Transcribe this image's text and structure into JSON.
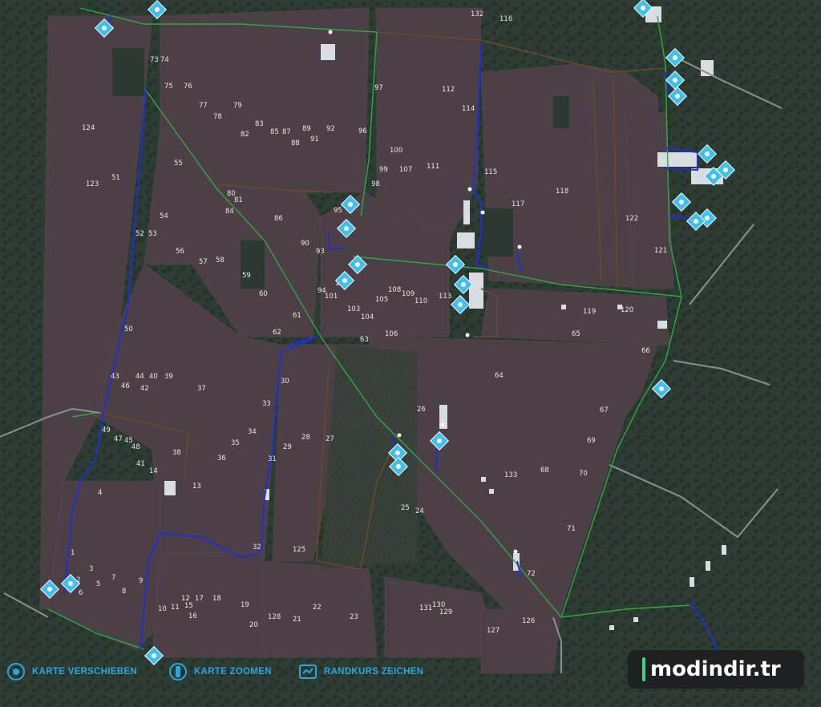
{
  "map": {
    "field_numbers": [
      {
        "label": "132",
        "pos": "a"
      },
      {
        "label": "116",
        "pos": "b"
      },
      {
        "label": "73",
        "pos": "c1"
      },
      {
        "label": "74",
        "pos": "c2"
      },
      {
        "label": "75",
        "pos": "d1"
      },
      {
        "label": "76",
        "pos": "d2"
      },
      {
        "label": "77",
        "pos": "e1"
      },
      {
        "label": "79",
        "pos": "e2"
      },
      {
        "label": "78",
        "pos": "e3"
      },
      {
        "label": "97",
        "pos": "f"
      },
      {
        "label": "112",
        "pos": "g"
      },
      {
        "label": "114",
        "pos": "h"
      },
      {
        "label": "124",
        "pos": "i"
      },
      {
        "label": "83",
        "pos": "j1"
      },
      {
        "label": "82",
        "pos": "j2"
      },
      {
        "label": "85",
        "pos": "j3"
      },
      {
        "label": "87",
        "pos": "j4"
      },
      {
        "label": "89",
        "pos": "j5"
      },
      {
        "label": "92",
        "pos": "j6"
      },
      {
        "label": "88",
        "pos": "j7"
      },
      {
        "label": "91",
        "pos": "j8"
      },
      {
        "label": "96",
        "pos": "k"
      },
      {
        "label": "100",
        "pos": "l"
      },
      {
        "label": "51",
        "pos": "m"
      },
      {
        "label": "123",
        "pos": "n"
      },
      {
        "label": "55",
        "pos": "o"
      },
      {
        "label": "99",
        "pos": "p1"
      },
      {
        "label": "107",
        "pos": "p2"
      },
      {
        "label": "111",
        "pos": "p3"
      },
      {
        "label": "115",
        "pos": "q"
      },
      {
        "label": "118",
        "pos": "r"
      },
      {
        "label": "98",
        "pos": "s"
      },
      {
        "label": "80",
        "pos": "t1"
      },
      {
        "label": "81",
        "pos": "t2"
      },
      {
        "label": "84",
        "pos": "t3"
      },
      {
        "label": "86",
        "pos": "t4"
      },
      {
        "label": "95",
        "pos": "u"
      },
      {
        "label": "117",
        "pos": "v"
      },
      {
        "label": "122",
        "pos": "w"
      },
      {
        "label": "54",
        "pos": "x"
      },
      {
        "label": "52",
        "pos": "y1"
      },
      {
        "label": "53",
        "pos": "y2"
      },
      {
        "label": "90",
        "pos": "z1"
      },
      {
        "label": "93",
        "pos": "z2"
      },
      {
        "label": "56",
        "pos": "aa"
      },
      {
        "label": "57",
        "pos": "ab1"
      },
      {
        "label": "58",
        "pos": "ab2"
      },
      {
        "label": "121",
        "pos": "ac"
      },
      {
        "label": "59",
        "pos": "ad"
      },
      {
        "label": "102",
        "pos": "ae"
      },
      {
        "label": "94",
        "pos": "af1"
      },
      {
        "label": "101",
        "pos": "af2"
      },
      {
        "label": "108",
        "pos": "ag1"
      },
      {
        "label": "109",
        "pos": "ag2"
      },
      {
        "label": "110",
        "pos": "ag3"
      },
      {
        "label": "105",
        "pos": "ag4"
      },
      {
        "label": "113",
        "pos": "ah"
      },
      {
        "label": "60",
        "pos": "ai"
      },
      {
        "label": "103",
        "pos": "aj"
      },
      {
        "label": "61",
        "pos": "ak1"
      },
      {
        "label": "104",
        "pos": "ak2"
      },
      {
        "label": "119",
        "pos": "al"
      },
      {
        "label": "120",
        "pos": "am"
      },
      {
        "label": "50",
        "pos": "an"
      },
      {
        "label": "62",
        "pos": "ao"
      },
      {
        "label": "106",
        "pos": "ap"
      },
      {
        "label": "65",
        "pos": "aq"
      },
      {
        "label": "63",
        "pos": "ar"
      },
      {
        "label": "66",
        "pos": "as"
      },
      {
        "label": "43",
        "pos": "at1"
      },
      {
        "label": "44",
        "pos": "at2"
      },
      {
        "label": "40",
        "pos": "at3"
      },
      {
        "label": "39",
        "pos": "at4"
      },
      {
        "label": "46",
        "pos": "at5"
      },
      {
        "label": "42",
        "pos": "at6"
      },
      {
        "label": "37",
        "pos": "au"
      },
      {
        "label": "30",
        "pos": "av"
      },
      {
        "label": "64",
        "pos": "aw"
      },
      {
        "label": "33",
        "pos": "ax"
      },
      {
        "label": "26",
        "pos": "ay"
      },
      {
        "label": "67",
        "pos": "az"
      },
      {
        "label": "49",
        "pos": "ba"
      },
      {
        "label": "47",
        "pos": "bb1"
      },
      {
        "label": "45",
        "pos": "bb2"
      },
      {
        "label": "48",
        "pos": "bb3"
      },
      {
        "label": "35",
        "pos": "bc"
      },
      {
        "label": "34",
        "pos": "bd"
      },
      {
        "label": "28",
        "pos": "be"
      },
      {
        "label": "27",
        "pos": "bf"
      },
      {
        "label": "29",
        "pos": "bg"
      },
      {
        "label": "69",
        "pos": "bh"
      },
      {
        "label": "38",
        "pos": "bi"
      },
      {
        "label": "36",
        "pos": "bj"
      },
      {
        "label": "41",
        "pos": "bk"
      },
      {
        "label": "31",
        "pos": "bl"
      },
      {
        "label": "14",
        "pos": "bm"
      },
      {
        "label": "68",
        "pos": "bn"
      },
      {
        "label": "133",
        "pos": "bo"
      },
      {
        "label": "70",
        "pos": "bp"
      },
      {
        "label": "13",
        "pos": "bq"
      },
      {
        "label": "4",
        "pos": "br"
      },
      {
        "label": "25",
        "pos": "bs1"
      },
      {
        "label": "24",
        "pos": "bs2"
      },
      {
        "label": "71",
        "pos": "bt"
      },
      {
        "label": "32",
        "pos": "bu"
      },
      {
        "label": "125",
        "pos": "bv"
      },
      {
        "label": "72",
        "pos": "bw"
      },
      {
        "label": "1",
        "pos": "bx"
      },
      {
        "label": "3",
        "pos": "by1"
      },
      {
        "label": "7",
        "pos": "by2"
      },
      {
        "label": "5",
        "pos": "by3"
      },
      {
        "label": "9",
        "pos": "by4"
      },
      {
        "label": "6",
        "pos": "by5"
      },
      {
        "label": "8",
        "pos": "by6"
      },
      {
        "label": "2",
        "pos": "by7"
      },
      {
        "label": "12",
        "pos": "bz1"
      },
      {
        "label": "17",
        "pos": "bz2"
      },
      {
        "label": "18",
        "pos": "bz3"
      },
      {
        "label": "10",
        "pos": "bz4"
      },
      {
        "label": "11",
        "pos": "bz5"
      },
      {
        "label": "15",
        "pos": "bz6"
      },
      {
        "label": "16",
        "pos": "bz7"
      },
      {
        "label": "19",
        "pos": "ca"
      },
      {
        "label": "22",
        "pos": "cb"
      },
      {
        "label": "128",
        "pos": "cc1"
      },
      {
        "label": "21",
        "pos": "cc2"
      },
      {
        "label": "20",
        "pos": "cc3"
      },
      {
        "label": "23",
        "pos": "cd"
      },
      {
        "label": "131",
        "pos": "ce1"
      },
      {
        "label": "130",
        "pos": "ce2"
      },
      {
        "label": "129",
        "pos": "ce3"
      },
      {
        "label": "126",
        "pos": "cf"
      },
      {
        "label": "127",
        "pos": "cg"
      }
    ]
  },
  "controls": {
    "move_map": "KARTE VERSCHIEBEN",
    "zoom_map": "KARTE ZOOMEN",
    "draw_border": "RANDKURS ZEICHEN"
  },
  "watermark": "modindir.tr",
  "colors": {
    "field": "#4c3f45",
    "forest": "#2f3f35",
    "route_blue": "#1e2fd6",
    "route_green": "#2fa840",
    "road_brown": "#6a4a2a",
    "poi_cyan": "#3fc0ee",
    "hint_text": "#29a6e6",
    "watermark_bg": "#1f2023"
  }
}
